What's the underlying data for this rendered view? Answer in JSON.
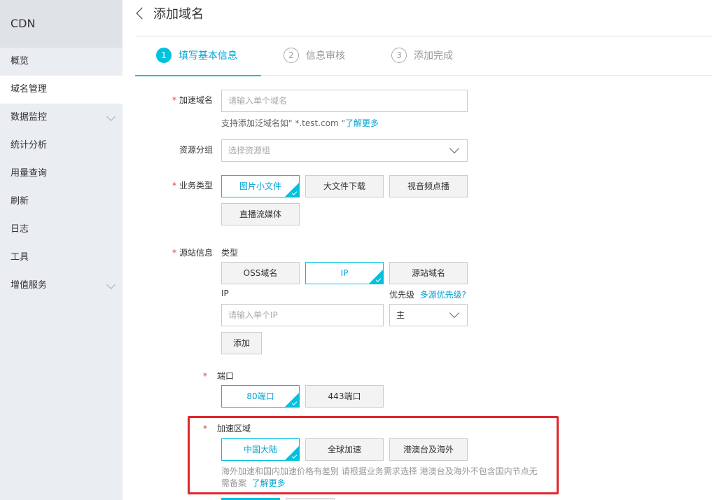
{
  "sidebar": {
    "brand": "CDN",
    "items": [
      {
        "label": "概览"
      },
      {
        "label": "域名管理"
      },
      {
        "label": "数据监控"
      },
      {
        "label": "统计分析"
      },
      {
        "label": "用量查询"
      },
      {
        "label": "刷新"
      },
      {
        "label": "日志"
      },
      {
        "label": "工具"
      },
      {
        "label": "增值服务"
      }
    ]
  },
  "header": {
    "title": "添加域名"
  },
  "steps": [
    {
      "num": "1",
      "label": "填写基本信息"
    },
    {
      "num": "2",
      "label": "信息审核"
    },
    {
      "num": "3",
      "label": "添加完成"
    }
  ],
  "form": {
    "domain": {
      "label": "加速域名",
      "placeholder": "请输入单个域名",
      "hint_prefix": "支持添加泛域名如\" *.test.com \"",
      "hint_link": "了解更多"
    },
    "resource_group": {
      "label": "资源分组",
      "placeholder": "选择资源组"
    },
    "business_type": {
      "label": "业务类型",
      "options": [
        "图片小文件",
        "大文件下载",
        "视音频点播",
        "直播流媒体"
      ]
    },
    "origin": {
      "label": "源站信息",
      "type_label": "类型",
      "types": [
        "OSS域名",
        "IP",
        "源站域名"
      ],
      "ip_label": "IP",
      "ip_placeholder": "请输入单个IP",
      "priority_label": "优先级",
      "priority_link": "多源优先级?",
      "priority_value": "主",
      "add_label": "添加"
    },
    "port": {
      "label": "端口",
      "options": [
        "80端口",
        "443端口"
      ]
    },
    "region": {
      "label": "加速区域",
      "options": [
        "中国大陆",
        "全球加速",
        "港澳台及海外"
      ],
      "hint": "海外加速和国内加速价格有差别 请根据业务需求选择 港澳台及海外不包含国内节点无需备案",
      "hint_link": "了解更多"
    }
  }
}
